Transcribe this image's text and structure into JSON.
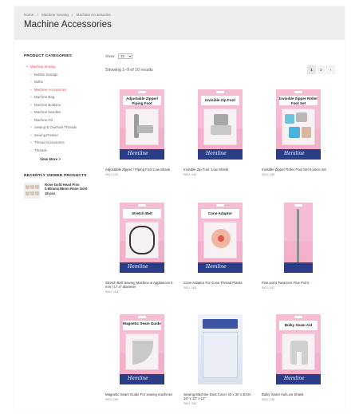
{
  "breadcrumb": [
    "Home",
    "/",
    "Machine Sewing",
    "/",
    "Machine Accessories"
  ],
  "title": "Machine Accessories",
  "sidebar": {
    "categories_heading": "PRODUCT CATEGORIES",
    "categories": [
      {
        "label": "Machine Sewing",
        "active": true,
        "sub": false
      },
      {
        "label": "Bobbin Storage",
        "active": false,
        "sub": true
      },
      {
        "label": "Bulbs",
        "active": false,
        "sub": true
      },
      {
        "label": "Machine Accessories",
        "active": true,
        "sub": true
      },
      {
        "label": "Machine Bag",
        "active": false,
        "sub": true
      },
      {
        "label": "Machine Bobbins",
        "active": false,
        "sub": true
      },
      {
        "label": "Machine Needles",
        "active": false,
        "sub": true
      },
      {
        "label": "Machine Oil",
        "active": false,
        "sub": true
      },
      {
        "label": "Sewing & Overlock Threads",
        "active": false,
        "sub": true
      },
      {
        "label": "Sewing Presser",
        "active": false,
        "sub": true
      },
      {
        "label": "Thread Accessories",
        "active": false,
        "sub": true
      },
      {
        "label": "Threads",
        "active": false,
        "sub": true
      }
    ],
    "view_more": "View More >",
    "recent_heading": "RECENTLY VIEWED PRODUCTS",
    "recent_items": [
      {
        "title": "Rose Gold Head Pins 0.60mmx38mm Rose Gold 18 pcs"
      }
    ]
  },
  "toolbar": {
    "show_label": "Show",
    "show_value": "12",
    "results_text": "Showing 1–9 of 10 results",
    "pages": [
      "1",
      "2",
      "›"
    ]
  },
  "products": [
    {
      "card_label": "Adjustable Zipper/ Piping Foot",
      "name": "Adjustable Zipper / Piping Foot Low Shank",
      "sku": "SKU: 132"
    },
    {
      "card_label": "Invisible Zip Foot",
      "name": "Invisible Zip Foot: Low Shank",
      "sku": "SKU: 183"
    },
    {
      "card_label": "Invisible Zipper Roller Foot Set",
      "name": "Invisible Zipper Roller Foot Set 6 piece set",
      "sku": "SKU: 183"
    },
    {
      "card_label": "Stretch Belt",
      "name": "Stretch Belt Sewing Machine & Appliances 5 mm | 17.4\" diameter",
      "sku": "SKU: 163"
    },
    {
      "card_label": "Cone Adaptor",
      "name": "Cone Adaptor For Cone Thread Plastic",
      "sku": "SKU: 163"
    },
    {
      "card_label": "",
      "name": "Fine point Tweezers Fine Point",
      "sku": "SKU: 147"
    },
    {
      "card_label": "Magnetic Seam Guide",
      "name": "Magnetic Seam Guide For sewing machines",
      "sku": "SKU: 180"
    },
    {
      "card_label": "",
      "name": "Sewing Machine Dust Cover 40 x 30 x 30cm 16\" x 12\" x 12\"",
      "sku": "SKU: 151"
    },
    {
      "card_label": "Bulky Seam Aid",
      "name": "Bulky Seam Aid Low Shank",
      "sku": "SKU: 136"
    }
  ],
  "brand": "Hemline",
  "colors": {
    "accent": "#e8474c",
    "card_pink": "#f6bcd3",
    "brand_navy": "#2b3d86"
  }
}
